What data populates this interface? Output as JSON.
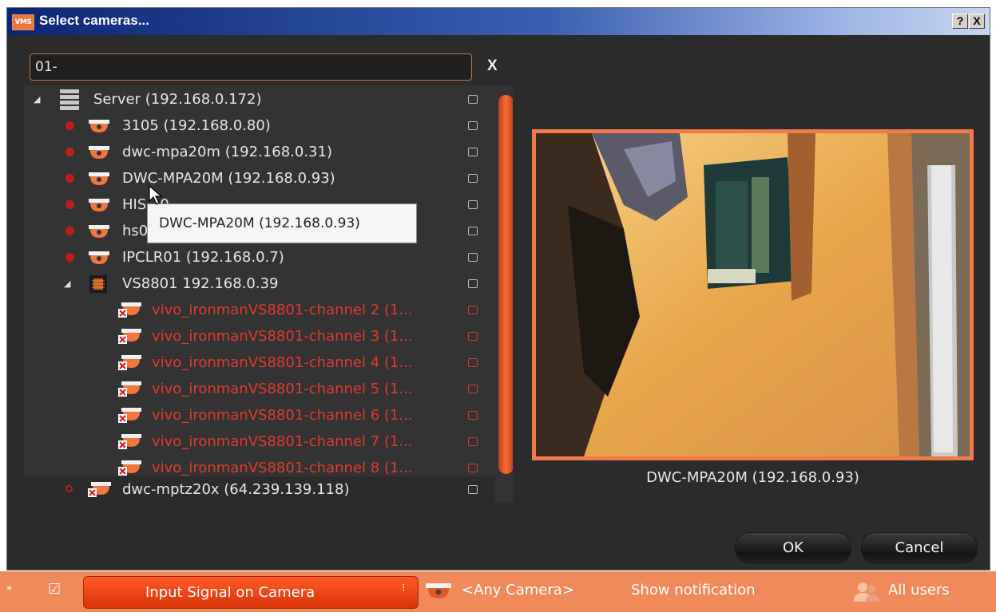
{
  "window": {
    "title": "Select cameras...",
    "app_icon_text": "VMS",
    "help_btn": "?",
    "close_btn": "X"
  },
  "search": {
    "value": "01-",
    "clear_label": "X"
  },
  "tree": {
    "items": [
      {
        "label": "Server (192.168.0.172)",
        "type": "server",
        "expanded": true
      },
      {
        "label": "3105 (192.168.0.80)",
        "type": "camera",
        "status": "red"
      },
      {
        "label": "dwc-mpa20m (192.168.0.31)",
        "type": "camera",
        "status": "red"
      },
      {
        "label": "DWC-MPA20M (192.168.0.93)",
        "type": "camera",
        "status": "red"
      },
      {
        "label": "HIS...0....",
        "type": "camera",
        "status": "red"
      },
      {
        "label": "hs01...",
        "type": "camera",
        "status": "red"
      },
      {
        "label": "IPCLR01 (192.168.0.7)",
        "type": "camera",
        "status": "red"
      },
      {
        "label": "VS8801 192.168.0.39",
        "type": "encoder",
        "expanded": true
      },
      {
        "label": "vivo_ironmanVS8801-channel 2 (1...",
        "type": "channel-offline"
      },
      {
        "label": "vivo_ironmanVS8801-channel 3 (1...",
        "type": "channel-offline"
      },
      {
        "label": "vivo_ironmanVS8801-channel 4 (1...",
        "type": "channel-offline"
      },
      {
        "label": "vivo_ironmanVS8801-channel 5 (1...",
        "type": "channel-offline"
      },
      {
        "label": "vivo_ironmanVS8801-channel 6 (1...",
        "type": "channel-offline"
      },
      {
        "label": "vivo_ironmanVS8801-channel 7 (1...",
        "type": "channel-offline"
      },
      {
        "label": "vivo_ironmanVS8801-channel 8 (1...",
        "type": "channel-offline"
      },
      {
        "label": "dwc-mptz20x (64.239.139.118)",
        "type": "camera-offline",
        "status": "hollow"
      }
    ]
  },
  "tooltip": {
    "text": "DWC-MPA20M (192.168.0.93)"
  },
  "preview": {
    "caption": "DWC-MPA20M (192.168.0.93)"
  },
  "buttons": {
    "ok": "OK",
    "cancel": "Cancel"
  },
  "bottombar": {
    "star": "*",
    "check": "☑",
    "event": "Input Signal on Camera",
    "camera": "<Any Camera>",
    "action": "Show notification",
    "users": "All users"
  },
  "colors": {
    "accent": "#f07a48",
    "offline_text": "#e03a2e",
    "dialog_bg": "#2b2b2b",
    "tree_bg": "#333333"
  }
}
